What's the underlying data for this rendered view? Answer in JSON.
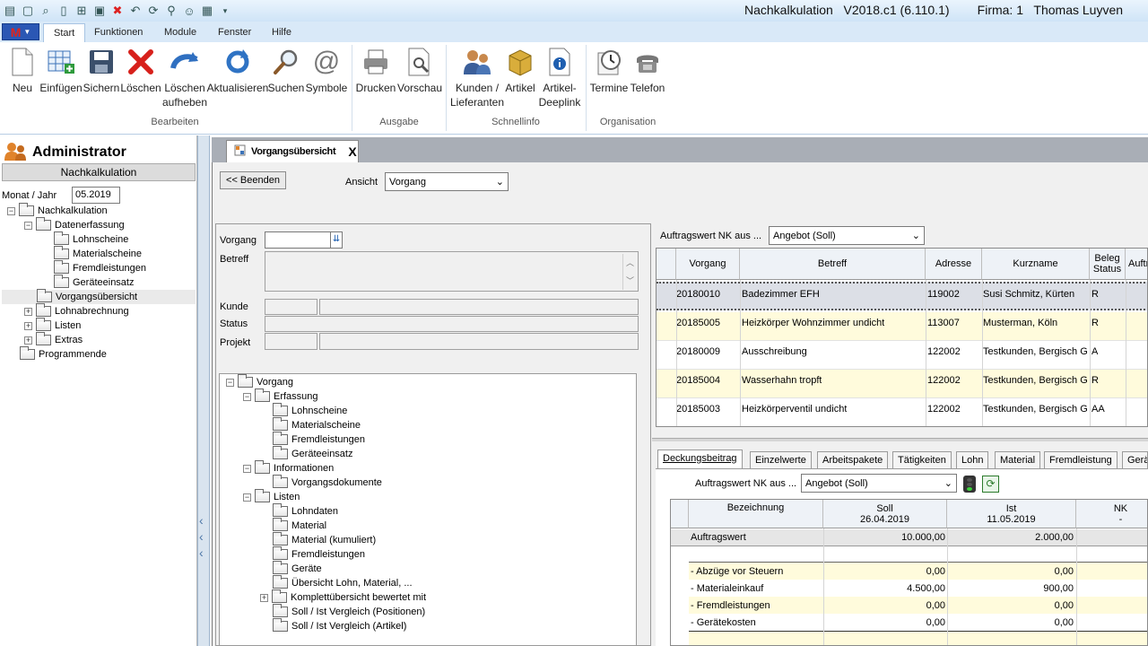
{
  "window": {
    "title": "Nachkalkulation   V2018.c1 (6.110.1)        Firma: 1   Thomas Luyven"
  },
  "menu": {
    "app": "M",
    "tabs": [
      "Start",
      "Funktionen",
      "Module",
      "Fenster",
      "Hilfe"
    ]
  },
  "ribbon": {
    "buttons": [
      {
        "label": "Neu",
        "icon": "new-document-icon"
      },
      {
        "label": "Einfügen",
        "icon": "insert-table-icon"
      },
      {
        "label": "Sichern",
        "icon": "save-icon"
      },
      {
        "label": "Löschen",
        "icon": "delete-icon"
      },
      {
        "label": "Löschen\naufheben",
        "icon": "undo-icon"
      },
      {
        "label": "Aktualisieren",
        "icon": "refresh-icon"
      },
      {
        "label": "Suchen",
        "icon": "search-icon"
      },
      {
        "label": "Symbole",
        "icon": "at-symbol-icon"
      },
      {
        "label": "Drucken",
        "icon": "printer-icon"
      },
      {
        "label": "Vorschau",
        "icon": "preview-icon"
      },
      {
        "label": "Kunden /\nLieferanten",
        "icon": "customers-icon"
      },
      {
        "label": "Artikel",
        "icon": "article-box-icon"
      },
      {
        "label": "Artikel-\nDeeplink",
        "icon": "info-icon"
      },
      {
        "label": "Termine",
        "icon": "calendar-clock-icon"
      },
      {
        "label": "Telefon",
        "icon": "phone-icon"
      }
    ],
    "groups": [
      "Bearbeiten",
      "Ausgabe",
      "Schnellinfo",
      "Organisation"
    ]
  },
  "sidebar": {
    "user": "Administrator",
    "module": "Nachkalkulation",
    "month_label": "Monat / Jahr",
    "month_value": "05.2019",
    "tree": [
      "Nachkalkulation",
      "Datenerfassung",
      "Lohnscheine",
      "Materialscheine",
      "Fremdleistungen",
      "Geräteeinsatz",
      "Vorgangsübersicht",
      "Lohnabrechnung",
      "Listen",
      "Extras",
      "Programmende"
    ]
  },
  "doc_tab": {
    "label": "Vorgangsübersicht",
    "close": "X"
  },
  "toolbar": {
    "end_button": "<< Beenden",
    "view_label": "Ansicht",
    "view_value": "Vorgang"
  },
  "form": {
    "vorgang": "Vorgang",
    "betreff": "Betreff",
    "kunde": "Kunde",
    "status": "Status",
    "projekt": "Projekt"
  },
  "vtree": [
    "Vorgang",
    "Erfassung",
    "Lohnscheine",
    "Materialscheine",
    "Fremdleistungen",
    "Geräteeinsatz",
    "Informationen",
    "Vorgangsdokumente",
    "Listen",
    "Lohndaten",
    "Material",
    "Material (kumuliert)",
    "Fremdleistungen",
    "Geräte",
    "Übersicht Lohn, Material, ...",
    "Komplettübersicht bewertet mit",
    "Soll / Ist Vergleich (Positionen)",
    "Soll / Ist Vergleich (Artikel)"
  ],
  "grid": {
    "nk_label": "Auftragswert NK aus ...",
    "nk_value": "Angebot (Soll)",
    "headers": [
      "Vorgang",
      "Betreff",
      "Adresse",
      "Kurzname",
      "Beleg\nStatus",
      "Auftr"
    ],
    "rows": [
      {
        "vorgang": "20180010",
        "betreff": "Badezimmer EFH",
        "adresse": "119002",
        "kurzname": "Susi Schmitz, Kürten",
        "status": "R"
      },
      {
        "vorgang": "20185005",
        "betreff": "Heizkörper Wohnzimmer undicht",
        "adresse": "113007",
        "kurzname": "Musterman, Köln",
        "status": "R"
      },
      {
        "vorgang": "20180009",
        "betreff": "Ausschreibung",
        "adresse": "122002",
        "kurzname": "Testkunden, Bergisch G",
        "status": "A"
      },
      {
        "vorgang": "20185004",
        "betreff": "Wasserhahn tropft",
        "adresse": "122002",
        "kurzname": "Testkunden, Bergisch G",
        "status": "R"
      },
      {
        "vorgang": "20185003",
        "betreff": "Heizkörperventil undicht",
        "adresse": "122002",
        "kurzname": "Testkunden, Bergisch G",
        "status": "AA"
      }
    ]
  },
  "bottom": {
    "tabs": [
      "Deckungsbeitrag",
      "Einzelwerte",
      "Arbeitspakete",
      "Tätigkeiten",
      "Lohn",
      "Material",
      "Fremdleistung",
      "Gerä"
    ],
    "nk_label": "Auftragswert NK aus ...",
    "nk_value": "Angebot (Soll)",
    "headers": {
      "bez": "Bezeichnung",
      "soll": "Soll",
      "soll_date": "26.04.2019",
      "ist": "Ist",
      "ist_date": "11.05.2019",
      "nk": "NK",
      "nk_sub": "-"
    },
    "rows": [
      {
        "bez": "Auftragswert",
        "soll": "10.000,00",
        "ist": "2.000,00"
      },
      {
        "bez": "-  Abzüge vor Steuern",
        "soll": "0,00",
        "ist": "0,00"
      },
      {
        "bez": "- Materialeinkauf",
        "soll": "4.500,00",
        "ist": "900,00"
      },
      {
        "bez": "- Fremdleistungen",
        "soll": "0,00",
        "ist": "0,00"
      },
      {
        "bez": "-  Gerätekosten",
        "soll": "0,00",
        "ist": "0,00"
      }
    ]
  }
}
